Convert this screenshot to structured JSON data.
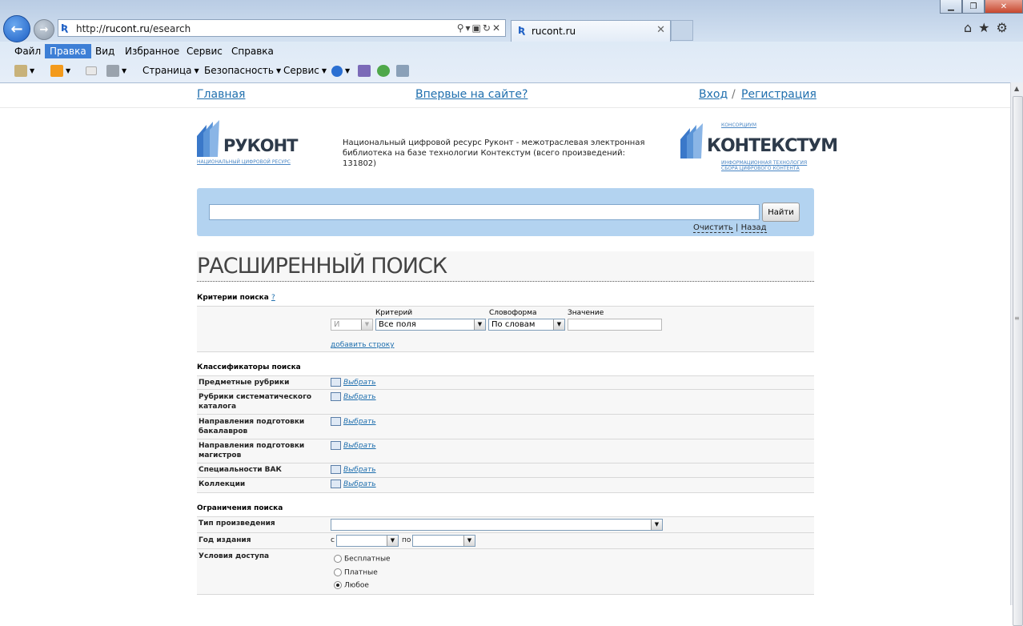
{
  "browser": {
    "address": {
      "prefix": "http://",
      "host": "rucont.ru",
      "path": "/esearch"
    },
    "tab_title": "rucont.ru",
    "menu": [
      "Файл",
      "Правка",
      "Вид",
      "Избранное",
      "Сервис",
      "Справка"
    ],
    "active_menu": "Правка",
    "commands": {
      "page": "Страница",
      "safety": "Безопасность",
      "tools": "Сервис"
    }
  },
  "topnav": {
    "home": "Главная",
    "first_time": "Впервые на сайте?",
    "login": "Вход",
    "separator": "/",
    "register": "Регистрация"
  },
  "logo_rukont": {
    "word": "РУКОНТ",
    "sub": "НАЦИОНАЛЬНЫЙ ЦИФРОВОЙ РЕСУРС"
  },
  "description": "Национальный цифровой ресурс Руконт - межотраслевая электронная библиотека на базе технологии Контекстум (всего произведений: 131802)",
  "logo_kontekstum": {
    "consortium": "КОНСОРЦИУМ",
    "word": "КОНТЕКСТУМ",
    "sub1": "ИНФОРМАЦИОННАЯ ТЕХНОЛОГИЯ",
    "sub2": "СБОРА ЦИФРОВОГО КОНТЕНТА"
  },
  "search": {
    "value": "",
    "button": "Найти",
    "clear": "Очистить",
    "sep": "|",
    "back": "Назад"
  },
  "heading": "РАСШИРЕННЫЙ ПОИСК",
  "criteria": {
    "title": "Критерии поиска",
    "help": "?",
    "col_criterion": "Критерий",
    "col_wordform": "Словоформа",
    "col_value": "Значение",
    "logic": "И",
    "criterion": "Все поля",
    "wordform": "По словам",
    "add_row": "добавить строку"
  },
  "classifiers": {
    "title": "Классификаторы поиска",
    "pick_label": "Выбрать",
    "items": [
      {
        "l1": "Предметные рубрики",
        "l2": ""
      },
      {
        "l1": "Рубрики систематического",
        "l2": "каталога"
      },
      {
        "l1": "Направления подготовки",
        "l2": "бакалавров"
      },
      {
        "l1": "Направления подготовки",
        "l2": "магистров"
      },
      {
        "l1": "Специальности ВАК",
        "l2": ""
      },
      {
        "l1": "Коллекции",
        "l2": ""
      }
    ]
  },
  "limits": {
    "title": "Ограничения поиска",
    "work_type": "Тип произведения",
    "year": "Год издания",
    "from": "с",
    "to": "по",
    "access": "Условия доступа",
    "access_options": [
      "Бесплатные",
      "Платные",
      "Любое"
    ],
    "access_selected": "Любое"
  }
}
